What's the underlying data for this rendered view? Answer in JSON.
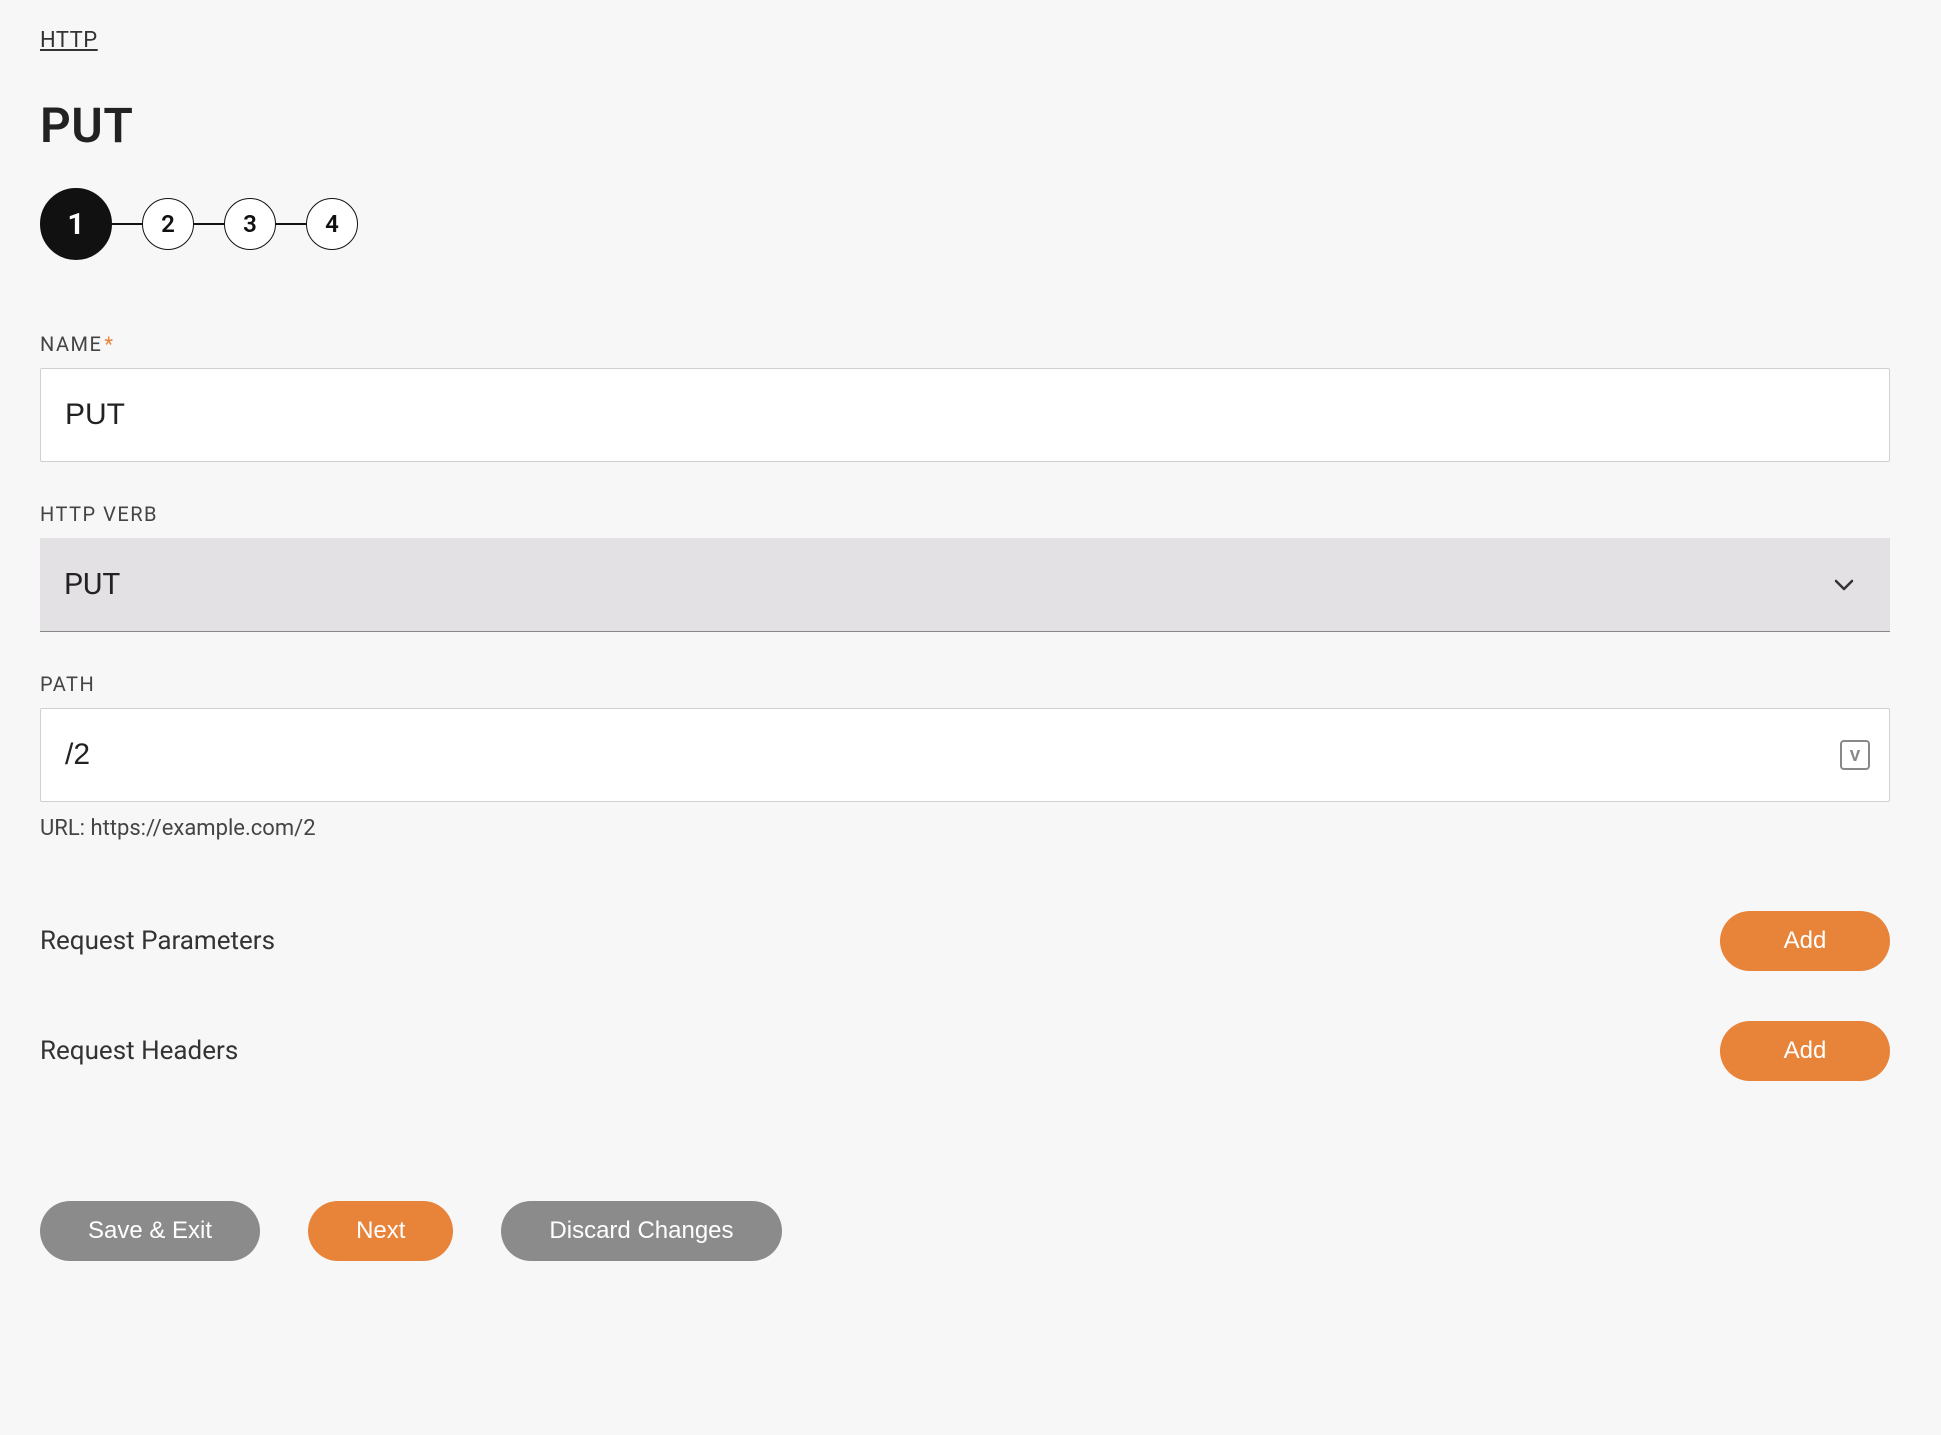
{
  "breadcrumb": {
    "parent": "HTTP"
  },
  "page": {
    "title": "PUT"
  },
  "stepper": {
    "steps": [
      "1",
      "2",
      "3",
      "4"
    ],
    "active_index": 0
  },
  "form": {
    "name": {
      "label": "NAME",
      "required_mark": "*",
      "value": "PUT"
    },
    "http_verb": {
      "label": "HTTP VERB",
      "value": "PUT"
    },
    "path": {
      "label": "PATH",
      "value": "/2",
      "variable_icon_char": "V",
      "url_helper": "URL: https://example.com/2"
    }
  },
  "sections": {
    "request_parameters": {
      "label": "Request Parameters",
      "add_label": "Add"
    },
    "request_headers": {
      "label": "Request Headers",
      "add_label": "Add"
    }
  },
  "footer": {
    "save_exit": "Save & Exit",
    "next": "Next",
    "discard": "Discard Changes"
  }
}
